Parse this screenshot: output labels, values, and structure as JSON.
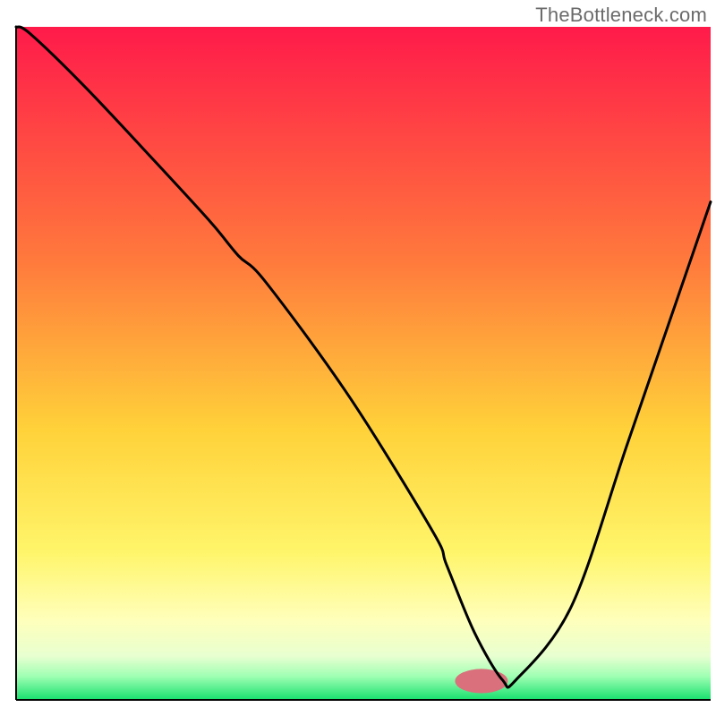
{
  "attribution": "TheBottleneck.com",
  "chart_data": {
    "type": "line",
    "title": "",
    "xlabel": "",
    "ylabel": "",
    "xlim": [
      0,
      100
    ],
    "ylim": [
      0,
      100
    ],
    "grid": false,
    "legend": false,
    "gradient_stops": [
      {
        "offset": 0.0,
        "color": "#ff1a4a"
      },
      {
        "offset": 0.35,
        "color": "#ff7a3c"
      },
      {
        "offset": 0.6,
        "color": "#ffd23a"
      },
      {
        "offset": 0.78,
        "color": "#fff56a"
      },
      {
        "offset": 0.88,
        "color": "#ffffba"
      },
      {
        "offset": 0.935,
        "color": "#e8ffd0"
      },
      {
        "offset": 0.965,
        "color": "#9fffb3"
      },
      {
        "offset": 1.0,
        "color": "#17e06e"
      }
    ],
    "series": [
      {
        "name": "bottleneck-curve",
        "x": [
          0,
          2,
          10,
          20,
          28,
          32,
          36,
          48,
          60,
          62,
          66,
          70,
          72,
          80,
          88,
          96,
          100
        ],
        "y": [
          100,
          99,
          91,
          80,
          71,
          66,
          62,
          45,
          25,
          20,
          10,
          3,
          3,
          14,
          38,
          62,
          74
        ]
      }
    ],
    "marker": {
      "cx": 67,
      "cy": 2.8,
      "rx": 3.8,
      "ry": 1.8,
      "color": "#d9707c"
    },
    "axes": {
      "stroke": "#000000",
      "width": 2
    }
  }
}
